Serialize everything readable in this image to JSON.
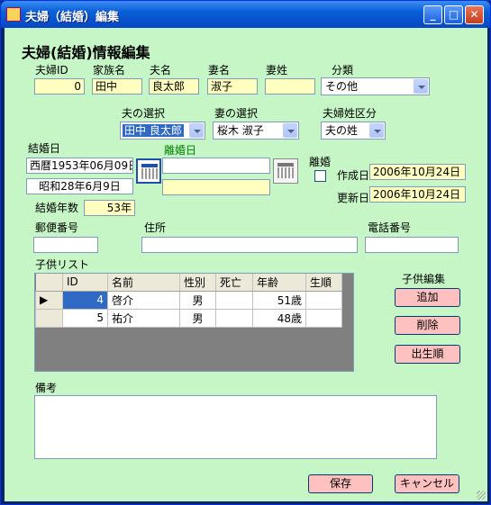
{
  "window": {
    "title": "夫婦（結婚）編集"
  },
  "form": {
    "heading": "夫婦(結婚)情報編集",
    "labels": {
      "couple_id": "夫婦ID",
      "family_name": "家族名",
      "husband_name": "夫名",
      "wife_name": "妻名",
      "wife_surname": "妻姓",
      "category": "分類",
      "husband_select": "夫の選択",
      "wife_select": "妻の選択",
      "surname_type": "夫婦姓区分",
      "marriage_date": "結婚日",
      "divorce_date": "離婚日",
      "divorce": "離婚",
      "created": "作成日",
      "updated": "更新日",
      "years_married": "結婚年数",
      "postal_code": "郵便番号",
      "address": "住所",
      "phone": "電話番号",
      "children_list": "子供リスト",
      "children_edit": "子供編集",
      "memo": "備考"
    },
    "values": {
      "couple_id": "0",
      "family_name": "田中",
      "husband_name": "良太郎",
      "wife_name": "淑子",
      "wife_surname": "",
      "category": "その他",
      "husband_select": "田中 良太郎",
      "wife_select": "桜木 淑子",
      "surname_type": "夫の姓",
      "marriage_date": "西暦1953年06月09日",
      "marriage_date_jp": "昭和28年6月9日",
      "divorce_date": "",
      "divorce_date_jp": "",
      "created": "2006年10月24日",
      "updated": "2006年10月24日",
      "years_married": "53年",
      "postal_code": "",
      "address": "",
      "phone": "",
      "memo": ""
    },
    "children": {
      "columns": [
        "ID",
        "名前",
        "性別",
        "死亡",
        "年齢",
        "生順"
      ],
      "rows": [
        {
          "id": "4",
          "name": "啓介",
          "gender": "男",
          "dead": "",
          "age": "51歳",
          "order": ""
        },
        {
          "id": "5",
          "name": "祐介",
          "gender": "男",
          "dead": "",
          "age": "48歳",
          "order": ""
        }
      ]
    },
    "buttons": {
      "add": "追加",
      "delete": "削除",
      "birth_order": "出生順",
      "save": "保存",
      "cancel": "キャンセル"
    }
  }
}
